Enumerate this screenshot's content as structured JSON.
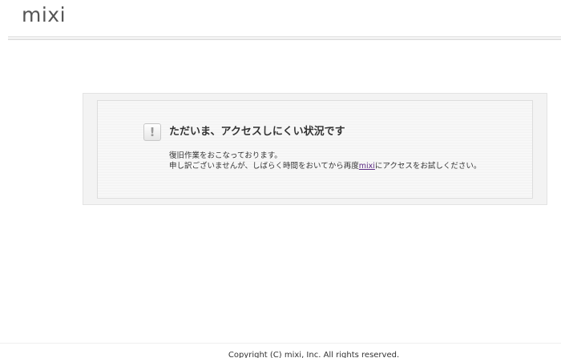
{
  "header": {
    "logo_text": "mixi"
  },
  "notice": {
    "icon": "exclamation-icon",
    "icon_glyph": "!",
    "title": "ただいま、アクセスしにくい状況です",
    "line1": "復旧作業をおこなっております。",
    "line2_before": "申し訳ございませんが、しばらく時間をおいてから再度",
    "link_text": "mixi",
    "line2_after": "にアクセスをお試しください。"
  },
  "footer": {
    "copyright": "Copyright (C) mixi, Inc. All rights reserved."
  },
  "colors": {
    "link": "#5a2a82",
    "text": "#333333",
    "panel_bg": "#f3f3f3"
  }
}
